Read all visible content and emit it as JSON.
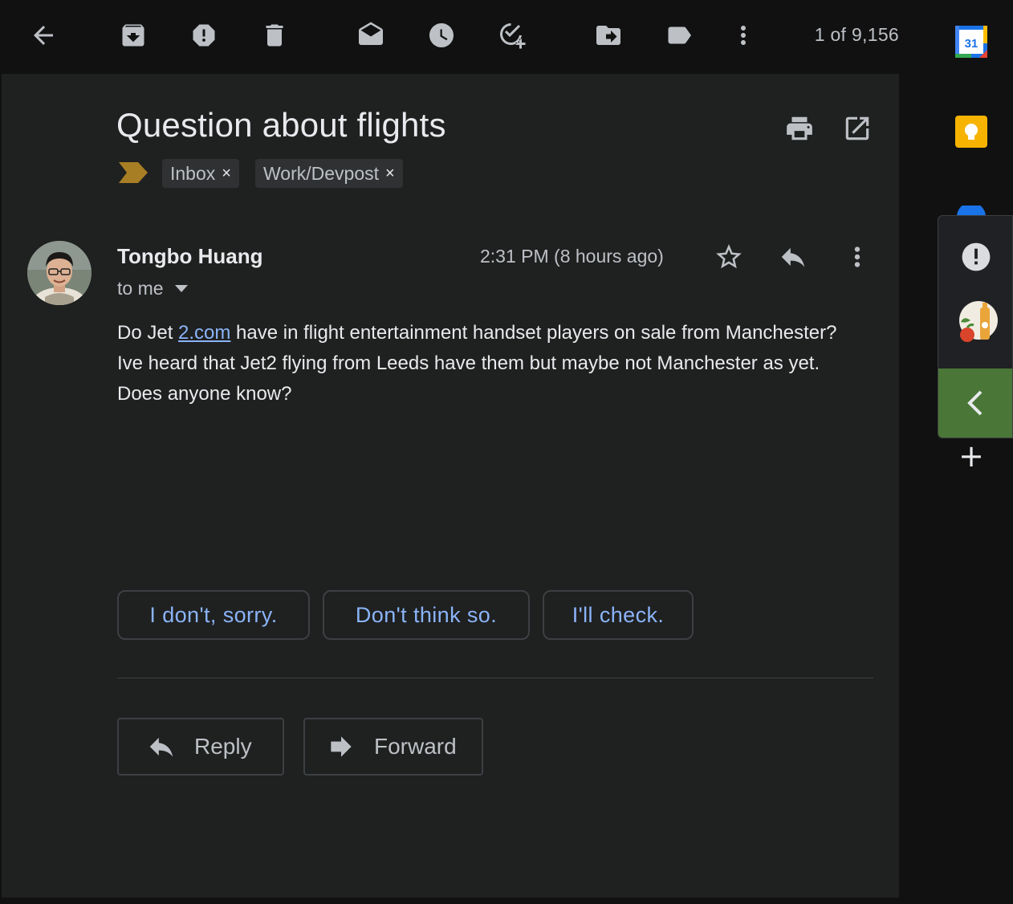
{
  "toolbar": {
    "count": "1 of 9,156"
  },
  "email": {
    "subject": "Question about flights",
    "labels": [
      "Inbox",
      "Work/Devpost"
    ],
    "label_remove": "×",
    "sender": "Tongbo Huang",
    "recipient": "to me",
    "time": "2:31 PM (8 hours ago)",
    "body_pre": "Do Jet ",
    "body_link": "2.com",
    "body_post": " have in flight entertainment handset players on sale from Manchester? Ive heard that Jet2 flying from Leeds have them but maybe not Manchester as yet. Does anyone know?"
  },
  "smart_replies": [
    "I don't, sorry.",
    "Don't think so.",
    "I'll check."
  ],
  "actions": {
    "reply": "Reply",
    "forward": "Forward"
  },
  "side": {
    "calendar_day": "31",
    "add": "+"
  },
  "colors": {
    "background": "#1f2020",
    "toolbar": "#111111",
    "link": "#8ab4f8",
    "importance": "#a87e25",
    "side_collapse": "#4a7737",
    "keep": "#f6b400"
  }
}
